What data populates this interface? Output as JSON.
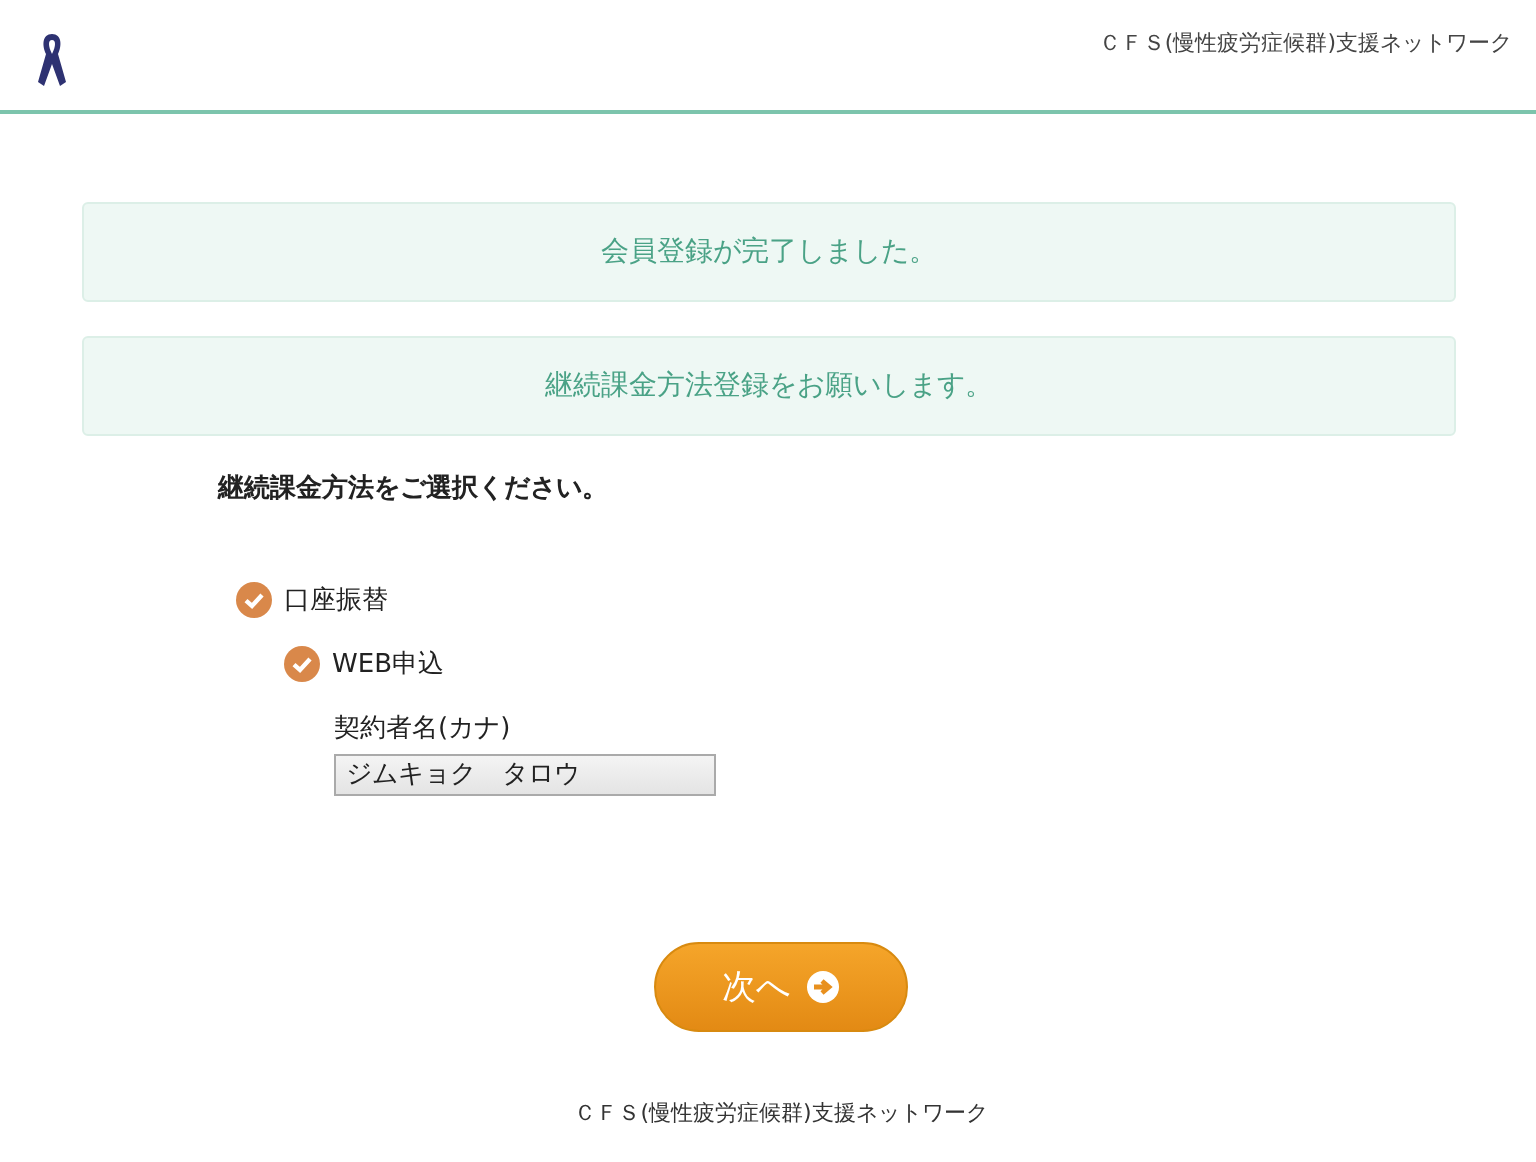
{
  "header": {
    "site_name": "ＣＦＳ(慢性疲労症候群)支援ネットワーク"
  },
  "notices": [
    "会員登録が完了しました。",
    "継続課金方法登録をお願いします。"
  ],
  "prompt": "継続課金方法をご選択ください。",
  "options": [
    {
      "label": "口座振替",
      "checked": true,
      "children": [
        {
          "label": "WEB申込",
          "checked": true
        }
      ]
    }
  ],
  "field": {
    "label": "契約者名(カナ)",
    "value": "ジムキョク　タロウ"
  },
  "next_button": {
    "label": "次へ"
  },
  "footer": "ＣＦＳ(慢性疲労症候群)支援ネットワーク"
}
